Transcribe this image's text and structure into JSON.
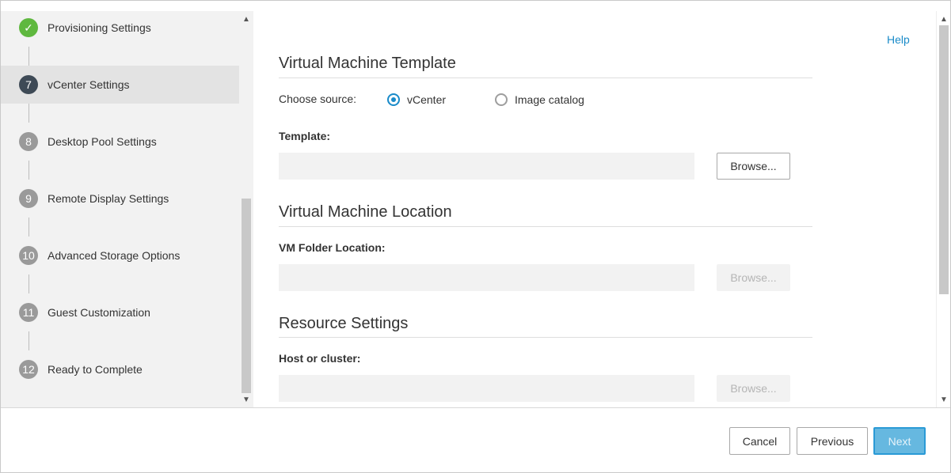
{
  "wizard": {
    "steps": [
      {
        "number": "✓",
        "label": "Provisioning Settings",
        "state": "done"
      },
      {
        "number": "7",
        "label": "vCenter Settings",
        "state": "current"
      },
      {
        "number": "8",
        "label": "Desktop Pool Settings",
        "state": "pending"
      },
      {
        "number": "9",
        "label": "Remote Display Settings",
        "state": "pending"
      },
      {
        "number": "10",
        "label": "Advanced Storage Options",
        "state": "pending"
      },
      {
        "number": "11",
        "label": "Guest Customization",
        "state": "pending"
      },
      {
        "number": "12",
        "label": "Ready to Complete",
        "state": "pending"
      }
    ]
  },
  "main": {
    "help_link": "Help",
    "vm_template": {
      "title": "Virtual Machine Template",
      "choose_source_label": "Choose source:",
      "options": [
        {
          "label": "vCenter",
          "checked": true
        },
        {
          "label": "Image catalog",
          "checked": false
        }
      ],
      "template_label": "Template:",
      "template_value": "",
      "browse_label": "Browse..."
    },
    "vm_location": {
      "title": "Virtual Machine Location",
      "folder_label": "VM Folder Location:",
      "folder_value": "",
      "browse_label": "Browse..."
    },
    "resource": {
      "title": "Resource Settings",
      "host_label": "Host or cluster:",
      "host_value": "",
      "browse_label": "Browse..."
    }
  },
  "footer": {
    "cancel": "Cancel",
    "previous": "Previous",
    "next": "Next"
  },
  "colors": {
    "accent": "#1a8bc9",
    "done": "#5fb83f",
    "current": "#3e4a56",
    "pending": "#9a9a9a"
  }
}
